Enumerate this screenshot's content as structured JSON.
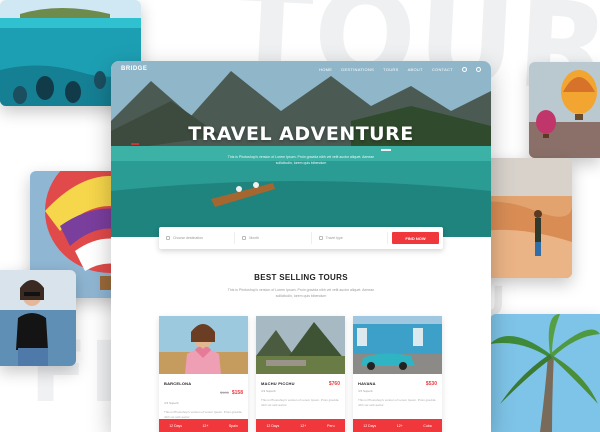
{
  "background": {
    "watermark_top": "TOUR",
    "watermark_left": "FI",
    "watermark_mid": "TOU"
  },
  "site": {
    "logo": "BRIDGE",
    "menu": [
      "HOME",
      "DESTINATIONS",
      "TOURS",
      "ABOUT",
      "CONTACT"
    ],
    "hero_title": "TRAVEL ADVENTURE",
    "hero_subtitle": "This is Photoshop's version of Lorem Ipsum. Proin gravida nibh vel velit auctor aliquet. Aenean sollicitudin, lorem quis bibendum",
    "search": {
      "destination_placeholder": "Choose destination",
      "month_placeholder": "Month",
      "type_placeholder": "Travel type",
      "button": "FIND NOW"
    },
    "section_title": "BEST SELLING TOURS",
    "section_subtitle": "This is Photoshop's version of Lorem Ipsum. Proin gravida nibh vel velit auctor aliquet. Aenean sollicitudin, lorem quis bibendum",
    "tours": [
      {
        "name": "BARCELONA",
        "old_price": "$180",
        "price": "$158",
        "reviews": "4.5 Superb",
        "desc": "This is Photoshop's version of Lorem Ipsum. Proin gravida nibh vel velit auctor",
        "days": "12 Days",
        "people": "12+",
        "place": "Spain"
      },
      {
        "name": "MACHU PICCHU",
        "old_price": "",
        "price": "$760",
        "reviews": "4.9 Superb",
        "desc": "This is Photoshop's version of Lorem Ipsum. Proin gravida nibh vel velit auctor",
        "days": "12 Days",
        "people": "12+",
        "place": "Peru"
      },
      {
        "name": "HAVANA",
        "old_price": "",
        "price": "$530",
        "reviews": "4.5 Superb",
        "desc": "This is Photoshop's version of Lorem Ipsum. Proin gravida nibh vel velit auctor",
        "days": "12 Days",
        "people": "12+",
        "place": "Cuba"
      }
    ]
  },
  "colors": {
    "accent": "#f0373c",
    "heading": "#222222"
  }
}
